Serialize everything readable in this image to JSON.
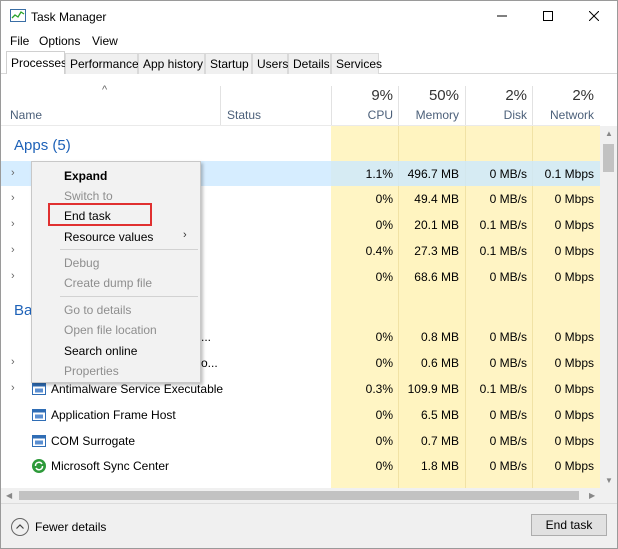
{
  "window": {
    "title": "Task Manager"
  },
  "menu": [
    "File",
    "Options",
    "View"
  ],
  "tabs": [
    "Processes",
    "Performance",
    "App history",
    "Startup",
    "Users",
    "Details",
    "Services"
  ],
  "header": {
    "name": "Name",
    "status": "Status",
    "cpu_pct": "9%",
    "cpu": "CPU",
    "mem_pct": "50%",
    "mem": "Memory",
    "disk_pct": "2%",
    "disk": "Disk",
    "net_pct": "2%",
    "net": "Network"
  },
  "groups": {
    "apps": "Apps (5)",
    "background": "Ba"
  },
  "rows": [
    {
      "name": "",
      "cpu": "1.1%",
      "mem": "496.7 MB",
      "disk": "0 MB/s",
      "net": "0.1 Mbps"
    },
    {
      "name": "",
      "cpu": "0%",
      "mem": "49.4 MB",
      "disk": "0 MB/s",
      "net": "0 Mbps"
    },
    {
      "name": "",
      "cpu": "0%",
      "mem": "20.1 MB",
      "disk": "0.1 MB/s",
      "net": "0 Mbps"
    },
    {
      "name": "",
      "cpu": "0.4%",
      "mem": "27.3 MB",
      "disk": "0.1 MB/s",
      "net": "0 Mbps"
    },
    {
      "name": "",
      "cpu": "0%",
      "mem": "68.6 MB",
      "disk": "0 MB/s",
      "net": "0 Mbps"
    },
    {
      "name": "...",
      "cpu": "0%",
      "mem": "0.8 MB",
      "disk": "0 MB/s",
      "net": "0 Mbps"
    },
    {
      "name": "o...",
      "cpu": "0%",
      "mem": "0.6 MB",
      "disk": "0 MB/s",
      "net": "0 Mbps"
    },
    {
      "name": "Antimalware Service Executable",
      "cpu": "0.3%",
      "mem": "109.9 MB",
      "disk": "0.1 MB/s",
      "net": "0 Mbps"
    },
    {
      "name": "Application Frame Host",
      "cpu": "0%",
      "mem": "6.5 MB",
      "disk": "0 MB/s",
      "net": "0 Mbps"
    },
    {
      "name": "COM Surrogate",
      "cpu": "0%",
      "mem": "0.7 MB",
      "disk": "0 MB/s",
      "net": "0 Mbps"
    },
    {
      "name": "Microsoft Sync Center",
      "cpu": "0%",
      "mem": "1.8 MB",
      "disk": "0 MB/s",
      "net": "0 Mbps"
    }
  ],
  "context_menu": {
    "expand": "Expand",
    "switch_to": "Switch to",
    "end_task": "End task",
    "resource_values": "Resource values",
    "debug": "Debug",
    "create_dump": "Create dump file",
    "go_to_details": "Go to details",
    "open_file_location": "Open file location",
    "search_online": "Search online",
    "properties": "Properties"
  },
  "footer": {
    "fewer_details": "Fewer details",
    "end_task": "End task"
  },
  "colors": {
    "accent": "#1e62b8",
    "selection": "#cce8ff",
    "heat": "#fff4c4",
    "highlight_box": "#e03030"
  }
}
